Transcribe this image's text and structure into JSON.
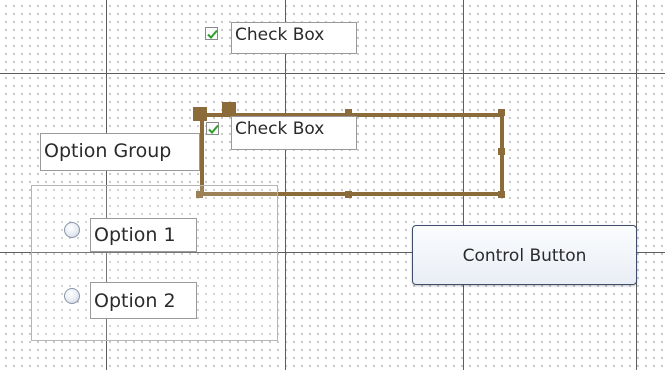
{
  "canvas": {
    "grid_color": "#5e5e5e",
    "dot_color": "#9a9a9a",
    "selection_color": "#8b6b3a",
    "check_color": "#2e9e2e"
  },
  "controls": {
    "checkbox_top": {
      "label": "Check Box",
      "checked": true,
      "icon": "checkmark-icon"
    },
    "checkbox_selected": {
      "label": "Check Box",
      "checked": true,
      "icon": "checkmark-icon",
      "selected": true
    },
    "option_group": {
      "label": "Option Group",
      "options": [
        {
          "label": "Option 1",
          "icon": "radio-button-icon"
        },
        {
          "label": "Option 2",
          "icon": "radio-button-icon"
        }
      ]
    },
    "control_button": {
      "label": "Control Button"
    }
  }
}
